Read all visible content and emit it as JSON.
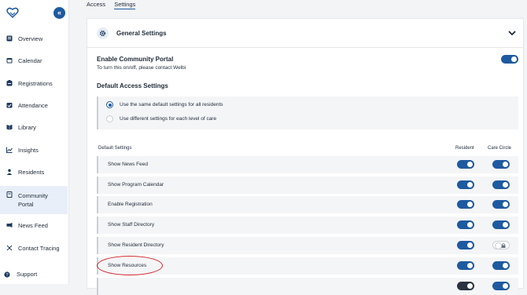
{
  "sidebar": {
    "items": [
      {
        "label": "Overview",
        "icon": "overview-icon"
      },
      {
        "label": "Calendar",
        "icon": "calendar-icon"
      },
      {
        "label": "Registrations",
        "icon": "registrations-icon"
      },
      {
        "label": "Attendance",
        "icon": "attendance-icon"
      },
      {
        "label": "Library",
        "icon": "library-icon"
      },
      {
        "label": "Insights",
        "icon": "insights-icon"
      },
      {
        "label": "Residents",
        "icon": "residents-icon"
      },
      {
        "label": "Community Portal",
        "icon": "community-portal-icon"
      },
      {
        "label": "News Feed",
        "icon": "news-feed-icon"
      },
      {
        "label": "Contact Tracing",
        "icon": "contact-tracing-icon"
      }
    ],
    "support_label": "Support",
    "active_item": "Community Portal"
  },
  "tabs": [
    {
      "label": "Access"
    },
    {
      "label": "Settings"
    }
  ],
  "active_tab": "Settings",
  "panel": {
    "title": "General Settings",
    "enable_portal_title": "Enable Community Portal",
    "enable_portal_sub": "To turn this on/off, please contact Welbi",
    "enable_portal_on": true,
    "access_title": "Default Access Settings",
    "radio_options": [
      {
        "label": "Use the same default settings for all residents",
        "selected": true
      },
      {
        "label": "Use different settings for each level of care",
        "selected": false
      }
    ],
    "columns": {
      "setting": "Default Settings",
      "resident": "Resident",
      "care": "Care Circle"
    },
    "rows": [
      {
        "label": "Show News Feed",
        "resident": true,
        "care": true
      },
      {
        "label": "Show Program Calendar",
        "resident": true,
        "care": true
      },
      {
        "label": "Enable Registration",
        "resident": true,
        "care": true
      },
      {
        "label": "Show Staff Directory",
        "resident": true,
        "care": true
      },
      {
        "label": "Show Resident Directory",
        "resident": true,
        "care": false,
        "care_locked": true
      },
      {
        "label": "Show Resources",
        "resident": true,
        "care": true
      }
    ]
  },
  "colors": {
    "accent": "#1e5aa0",
    "annotation": "#d2262b"
  }
}
